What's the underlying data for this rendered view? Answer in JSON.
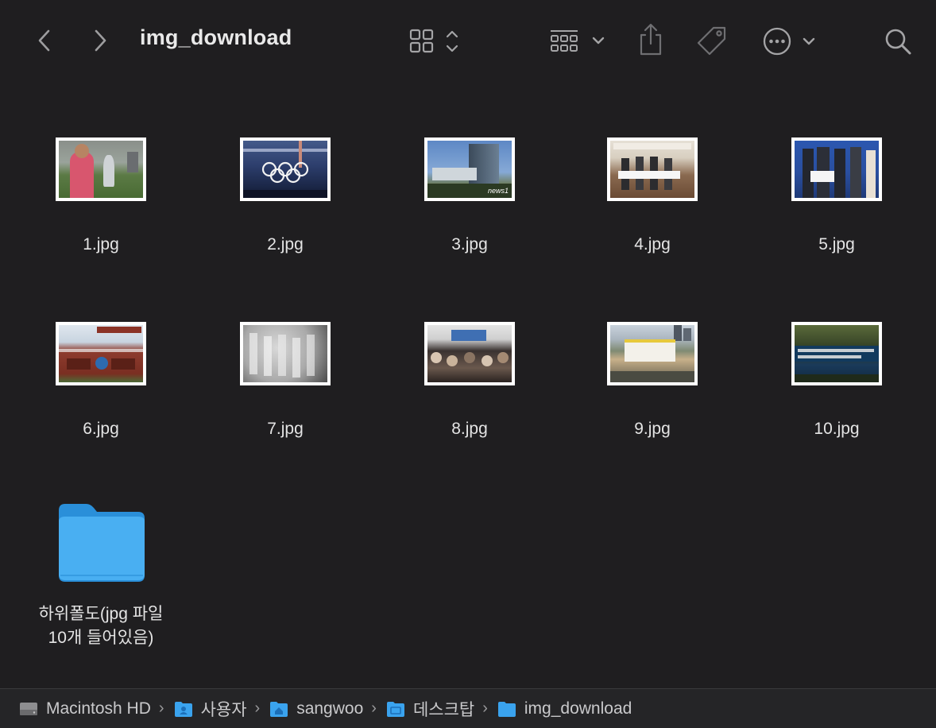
{
  "window": {
    "title": "img_download"
  },
  "toolbar": {
    "back_icon": "chevron-left-icon",
    "forward_icon": "chevron-right-icon",
    "view_icon": "grid-view-icon",
    "group_icon": "group-by-icon",
    "share_icon": "share-icon",
    "tag_icon": "tag-icon",
    "more_icon": "ellipsis-circle-icon",
    "search_icon": "search-icon"
  },
  "items": [
    {
      "name": "1.jpg"
    },
    {
      "name": "2.jpg"
    },
    {
      "name": "3.jpg"
    },
    {
      "name": "4.jpg"
    },
    {
      "name": "5.jpg"
    },
    {
      "name": "6.jpg"
    },
    {
      "name": "7.jpg"
    },
    {
      "name": "8.jpg"
    },
    {
      "name": "9.jpg"
    },
    {
      "name": "10.jpg"
    }
  ],
  "folder": {
    "name_line1": "하위폴도(jpg 파일",
    "name_line2": "10개 들어있음)"
  },
  "pathbar": [
    {
      "label": "Macintosh HD",
      "icon": "hard-drive-icon"
    },
    {
      "label": "사용자",
      "icon": "folder-icon"
    },
    {
      "label": "sangwoo",
      "icon": "home-folder-icon"
    },
    {
      "label": "데스크탑",
      "icon": "desktop-folder-icon"
    },
    {
      "label": "img_download",
      "icon": "folder-icon"
    }
  ],
  "colors": {
    "folder": "#3fa9f0",
    "accent": "#1e88e5"
  }
}
